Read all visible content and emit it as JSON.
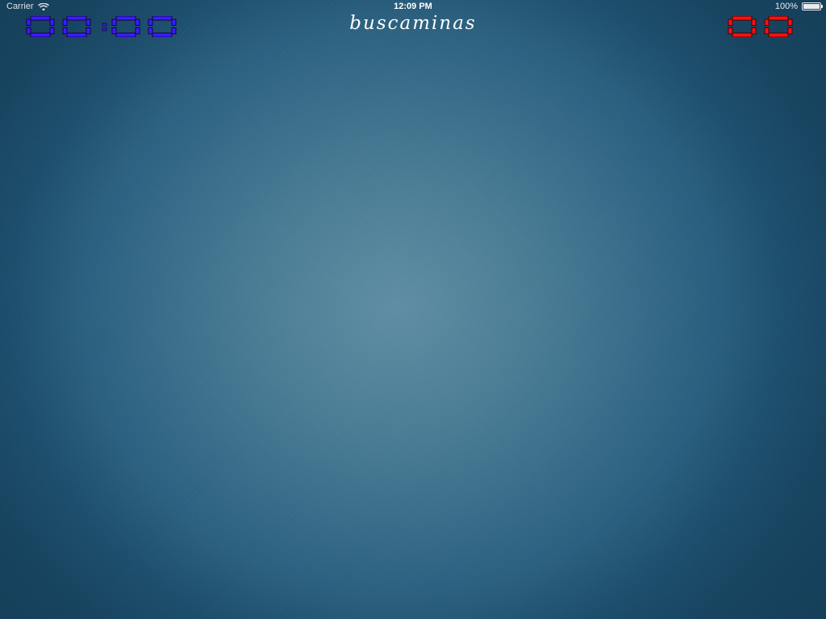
{
  "status_bar": {
    "carrier": "Carrier",
    "time": "12:09 PM",
    "battery": "100%"
  },
  "app": {
    "title": "buscaminas"
  },
  "timer": {
    "digits": [
      "0",
      "0",
      "0",
      "0"
    ],
    "separator": ":",
    "color": "#3a1cff",
    "stroke": "#12004a"
  },
  "mine_counter": {
    "digits": [
      "0",
      "0"
    ],
    "color": "#ff1010",
    "stroke": "#4a0000"
  },
  "background": {
    "texture": "blue-denim",
    "center_color": "#5f8ea4",
    "edge_color": "#1a4d6d"
  }
}
